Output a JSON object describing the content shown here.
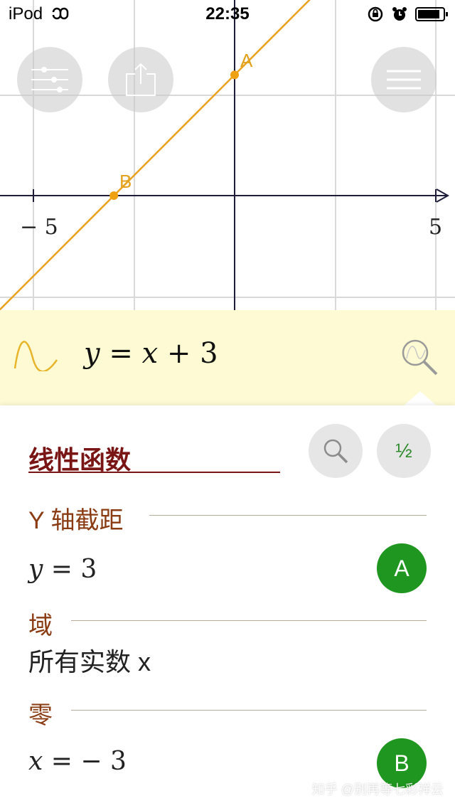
{
  "status_bar": {
    "device": "iPod",
    "time": "22:35"
  },
  "graph": {
    "x_tick_labels": [
      "− 5",
      "5"
    ],
    "points": [
      {
        "name": "A",
        "x": 0,
        "y": 3
      },
      {
        "name": "B",
        "x": -3,
        "y": 0
      }
    ],
    "line_color": "#e8a21b",
    "x_range": [
      -5.5,
      5.5
    ]
  },
  "toolbar": {
    "settings_icon": "sliders-icon",
    "share_icon": "share-icon",
    "menu_icon": "menu-icon"
  },
  "expression": {
    "y": "y",
    "eq": " = ",
    "x": "x",
    "rest": " + 3"
  },
  "panel": {
    "title": "线性函数",
    "half_label": "½",
    "sections": {
      "y_intercept": {
        "heading": "Y 轴截距",
        "var": "y",
        "rest": " = 3",
        "badge": "A"
      },
      "domain": {
        "heading": "域",
        "value": "所有实数 x"
      },
      "zeros": {
        "heading": "零",
        "var": "x",
        "rest": " =  − 3",
        "badge": "B"
      }
    }
  },
  "watermark": "知乎 @别再等七彩祥云"
}
